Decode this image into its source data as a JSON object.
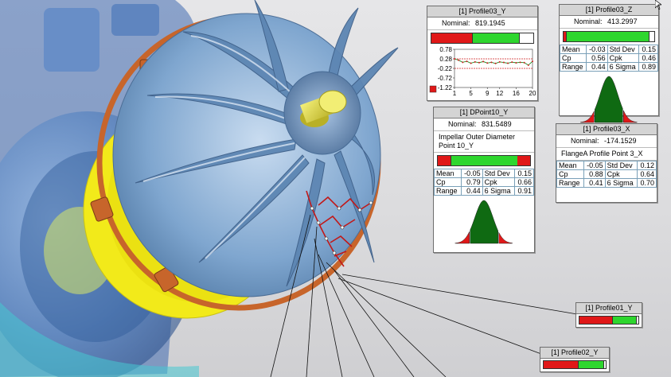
{
  "panels": {
    "profile03_y": {
      "title": "[1] Profile03_Y",
      "nominal_label": "Nominal:",
      "nominal_value": "819.1945",
      "bar": {
        "red_pct": 40,
        "green_pct": 45
      },
      "chart": {
        "y_ticks": [
          "0.78",
          "0.28",
          "-0.22",
          "-0.72",
          "-1.22"
        ],
        "x_ticks": [
          "1",
          "5",
          "9",
          "12",
          "16",
          "20"
        ],
        "values": [
          0.28,
          0.21,
          0.1,
          0.15,
          0.05,
          0.12,
          0.08,
          0.14,
          0.06,
          0.1,
          0.04,
          0.12,
          0.09,
          0.05,
          0.11,
          0.07,
          0.1,
          0.08,
          -0.05,
          0.15
        ]
      }
    },
    "profile03_z": {
      "title": "[1] Profile03_Z",
      "nominal_label": "Nominal:",
      "nominal_value": "413.2997",
      "bar": {
        "red_pct": 3,
        "green_pct": 90
      },
      "stats": [
        [
          "Mean",
          "-0.03",
          "Std Dev",
          "0.15"
        ],
        [
          "Cp",
          "0.56",
          "Cpk",
          "0.46"
        ],
        [
          "Range",
          "0.44",
          "6 Sigma",
          "0.89"
        ]
      ]
    },
    "dpoint10_y": {
      "title": "[1] DPoint10_Y",
      "nominal_label": "Nominal:",
      "nominal_value": "831.5489",
      "description": "Impellar Outer Diameter Point 10_Y",
      "bar": {
        "red_pct": 14,
        "green_pct": 72
      },
      "stats": [
        [
          "Mean",
          "-0.05",
          "Std Dev",
          "0.15"
        ],
        [
          "Cp",
          "0.79",
          "Cpk",
          "0.66"
        ],
        [
          "Range",
          "0.44",
          "6 Sigma",
          "0.91"
        ]
      ]
    },
    "profile03_x": {
      "title": "[1] Profile03_X",
      "nominal_label": "Nominal:",
      "nominal_value": "-174.1529",
      "description": "FlangeA Profile Point 3_X",
      "stats": [
        [
          "Mean",
          "-0.05",
          "Std Dev",
          "0.12"
        ],
        [
          "Cp",
          "0.88",
          "Cpk",
          "0.64"
        ],
        [
          "Range",
          "0.41",
          "6 Sigma",
          "0.70"
        ]
      ]
    },
    "profile01_y": {
      "title": "[1] Profile01_Y",
      "bar": {
        "red_pct": 55,
        "green_pct": 40
      }
    },
    "profile02_y": {
      "title": "[1] Profile02_Y",
      "bar": {
        "red_pct": 55,
        "green_pct": 40
      }
    }
  },
  "colors": {
    "red": "#e01818",
    "green": "#2ed62e",
    "dark_green": "#0f6a12",
    "impeller": "#7fa6cf",
    "yellow_ring": "#f2ea1a",
    "copper": "#c7652b"
  }
}
